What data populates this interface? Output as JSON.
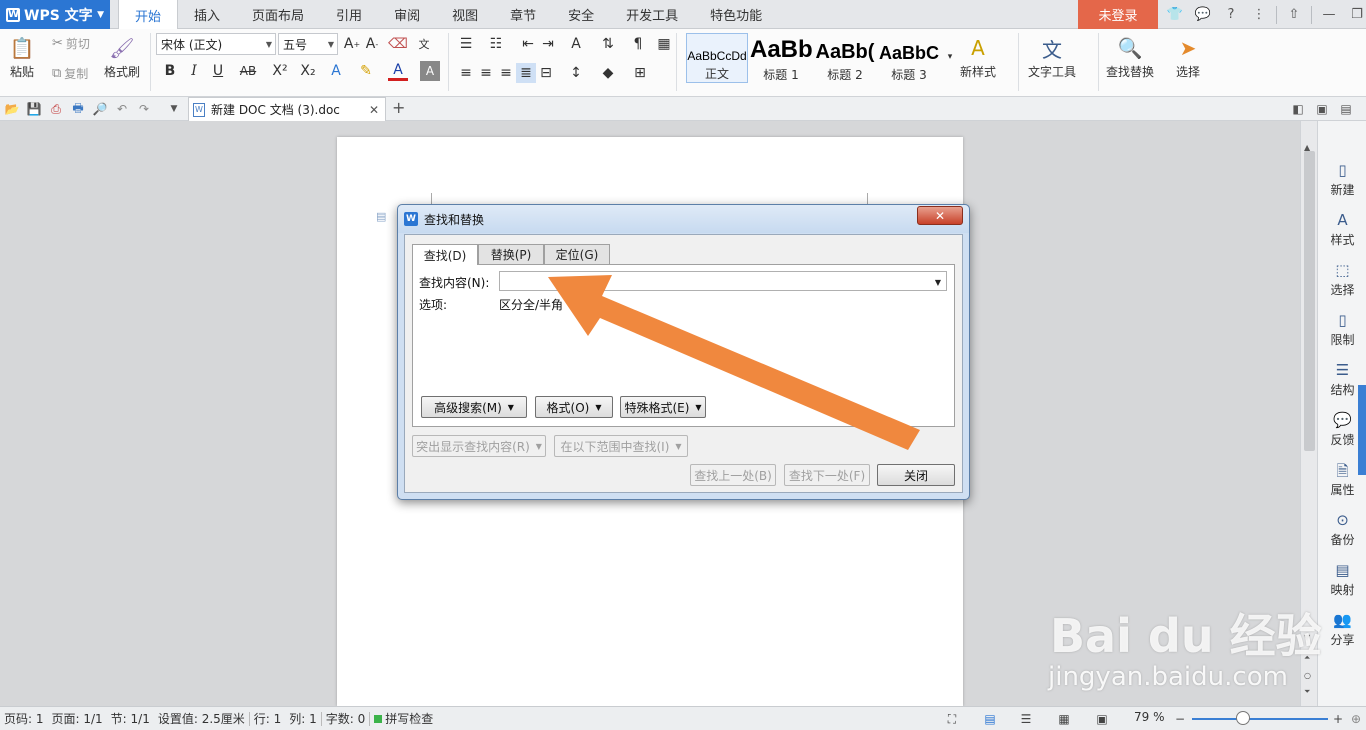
{
  "app": {
    "name": "WPS 文字",
    "login": "未登录"
  },
  "menu_tabs": [
    "开始",
    "插入",
    "页面布局",
    "引用",
    "审阅",
    "视图",
    "章节",
    "安全",
    "开发工具",
    "特色功能"
  ],
  "ribbon": {
    "paste": "粘贴",
    "cut": "剪切",
    "copy": "复制",
    "format_painter": "格式刷",
    "font_name": "宋体 (正文)",
    "font_size": "五号",
    "styles": [
      {
        "preview": "AaBbCcDd",
        "label": "正文"
      },
      {
        "preview": "AaBb",
        "label": "标题 1"
      },
      {
        "preview": "AaBb(",
        "label": "标题 2"
      },
      {
        "preview": "AaBbC",
        "label": "标题 3"
      }
    ],
    "new_style": "新样式",
    "text_tools": "文字工具",
    "find_replace": "查找替换",
    "select": "选择"
  },
  "doc_tab": {
    "name": "新建 DOC 文档 (3).doc"
  },
  "dialog": {
    "title": "查找和替换",
    "tabs": [
      "查找(D)",
      "替换(P)",
      "定位(G)"
    ],
    "find_label": "查找内容(N):",
    "find_value": "",
    "options_label": "选项:",
    "options_value": "区分全/半角",
    "buttons": {
      "advanced": "高级搜索(M)",
      "format": "格式(O)",
      "special": "特殊格式(E)",
      "highlight": "突出显示查找内容(R)",
      "find_in": "在以下范围中查找(I)",
      "prev": "查找上一处(B)",
      "next": "查找下一处(F)",
      "close": "关闭"
    }
  },
  "side_panel": [
    "新建",
    "样式",
    "选择",
    "限制",
    "结构",
    "反馈",
    "属性",
    "备份",
    "映射",
    "分享"
  ],
  "status": {
    "page_code": "页码: 1",
    "page": "页面: 1/1",
    "section": "节: 1/1",
    "setting": "设置值: 2.5厘米",
    "row": "行: 1",
    "col": "列: 1",
    "chars": "字数: 0",
    "spell": "拼写检查",
    "zoom": "79 %"
  },
  "watermark": {
    "top": "Bai du 经验",
    "bottom": "jingyan.baidu.com"
  },
  "colors": {
    "accent": "#2b76d3",
    "login": "#e4674a",
    "arrow": "#f0883e"
  }
}
